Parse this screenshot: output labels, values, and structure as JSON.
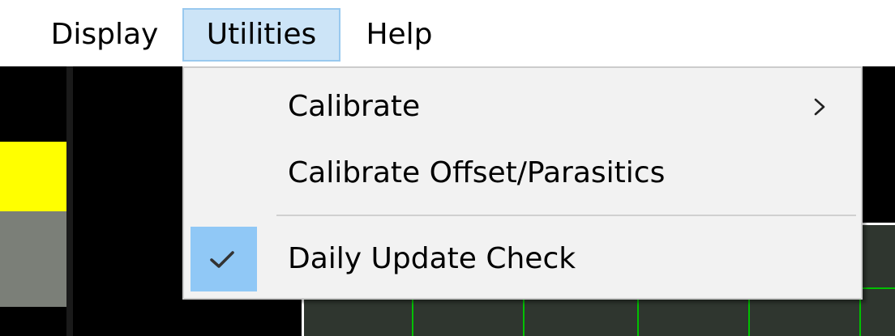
{
  "menubar": {
    "items": [
      {
        "label": "Display"
      },
      {
        "label": "Utilities"
      },
      {
        "label": "Help"
      }
    ]
  },
  "dropdown": {
    "items": [
      {
        "label": "Calibrate",
        "has_submenu": true
      },
      {
        "label": "Calibrate Offset/Parasitics"
      },
      {
        "label": "Daily Update Check",
        "checked": true
      }
    ]
  },
  "colors": {
    "menu_highlight": "#cce4f7",
    "check_highlight": "#90c8f6",
    "swatch_yellow": "#ffff00",
    "swatch_gray": "#7b7f78",
    "grid_green": "#00c000"
  },
  "icons": [
    "chevron-right-icon",
    "checkmark-icon"
  ]
}
